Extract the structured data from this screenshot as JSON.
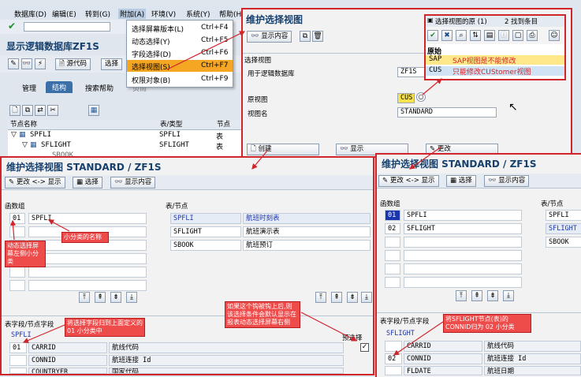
{
  "menu": [
    "数据库(D)",
    "编辑(E)",
    "转到(G)",
    "附加(A)",
    "环境(V)",
    "系统(Y)",
    "帮助(H)"
  ],
  "main_title": "显示逻辑数据库ZF1S",
  "main_toolbar": {
    "source_code": "源代码",
    "select": "选择"
  },
  "tabs": {
    "manage": "管理",
    "structure": "结构",
    "search_help": "搜索帮助",
    "view_hint": "页而"
  },
  "tree": {
    "headers": {
      "name": "节点名称",
      "type": "表/类型",
      "node": "节点"
    },
    "rows": [
      {
        "name": "SPFLI",
        "type": "SPFLI",
        "node": "表"
      },
      {
        "name": "SFLIGHT",
        "type": "SFLIGHT",
        "node": "表"
      },
      {
        "name": "SBOOK",
        "type": "SBOOK",
        "node": ""
      }
    ]
  },
  "dropdown": {
    "items": [
      {
        "label": "选择屏幕版本(L)",
        "shortcut": "Ctrl+F4"
      },
      {
        "label": "动态选择(Y)",
        "shortcut": "Ctrl+F5"
      },
      {
        "label": "字段选择(D)",
        "shortcut": "Ctrl+F6"
      },
      {
        "label": "选择视图(S)",
        "shortcut": "Ctrl+F7"
      },
      {
        "label": "权限对象(B)",
        "shortcut": "Ctrl+F9"
      }
    ]
  },
  "maintain": {
    "title": "维护选择视图",
    "display_content": "显示内容",
    "group_title": "选择视图",
    "labels": {
      "ldb": "用于逻辑数据库",
      "origin": "原视图",
      "view_name": "视图名"
    },
    "values": {
      "ldb": "ZF1S",
      "origin": "CUS",
      "view_name": "STANDARD"
    },
    "buttons": {
      "create": "创建",
      "display": "显示",
      "change": "更改"
    }
  },
  "popup": {
    "title": "选择视图的原 (1)",
    "count": "2 找到条目",
    "header": "原始",
    "rows": [
      {
        "code": "SAP",
        "text": "SAP视图是不能修改"
      },
      {
        "code": "CUS",
        "text": "只能修改CUStomer视图"
      }
    ]
  },
  "left": {
    "title": "维护选择视图 STANDARD / ZF1S",
    "toolbar": {
      "change_display": "更改 <-> 显示",
      "select": "选择",
      "display_content": "显示内容"
    },
    "func_group": "函数组",
    "groups": [
      {
        "no": "01",
        "name": "SPFLI"
      }
    ],
    "table_node": "表/节点",
    "nodes": [
      {
        "node": "SPFLI",
        "desc": "航班时刻表"
      },
      {
        "node": "SFLIGHT",
        "desc": "航班演示表"
      },
      {
        "node": "SBOOK",
        "desc": "航班预订"
      }
    ],
    "field_section": "表字段/节点字段",
    "field_node": "SPFLI",
    "pre_select": "预选择",
    "fields": [
      {
        "fg": "01",
        "name": "CARRID",
        "desc": "航线代码"
      },
      {
        "fg": "",
        "name": "CONNID",
        "desc": "航班连接 Id"
      },
      {
        "fg": "",
        "name": "COUNTRYFR",
        "desc": "国家代码"
      }
    ]
  },
  "right": {
    "title": "维护选择视图 STANDARD / ZF1S",
    "toolbar": {
      "change_display": "更改 <-> 显示",
      "select": "选择",
      "display_content": "显示内容"
    },
    "func_group": "函数组",
    "groups": [
      {
        "no": "01",
        "name": "SPFLI"
      },
      {
        "no": "02",
        "name": "SFLIGHT"
      }
    ],
    "table_node": "表/节点",
    "nodes": [
      {
        "node": "SPFLI",
        "desc": ""
      },
      {
        "node": "SFLIGHT",
        "desc": ""
      },
      {
        "node": "SBOOK",
        "desc": ""
      }
    ],
    "field_section": "表字段/节点字段",
    "field_node": "SFLIGHT",
    "fields": [
      {
        "fg": "",
        "name": "CARRID",
        "desc": "航线代码"
      },
      {
        "fg": "02",
        "name": "CONNID",
        "desc": "航班连接 Id"
      },
      {
        "fg": "",
        "name": "FLDATE",
        "desc": "航班日期"
      }
    ]
  },
  "notes": {
    "dyn": "动态选择屏幕左侧小分类",
    "cat": "小分类的名称",
    "field_assign": "将选择字段归到上面定义的 01 小分类中",
    "checkbox": "如果这个钩被钩上后,则该选择条件会默认显示在报表动态选择屏幕右侧",
    "sflight": "将SFLIGHT节点(表)的CONNID归为 02 小分类"
  },
  "colors": {
    "accent_red": "#d0252b",
    "title_blue": "#17406d",
    "highlight": "#f5a623"
  }
}
